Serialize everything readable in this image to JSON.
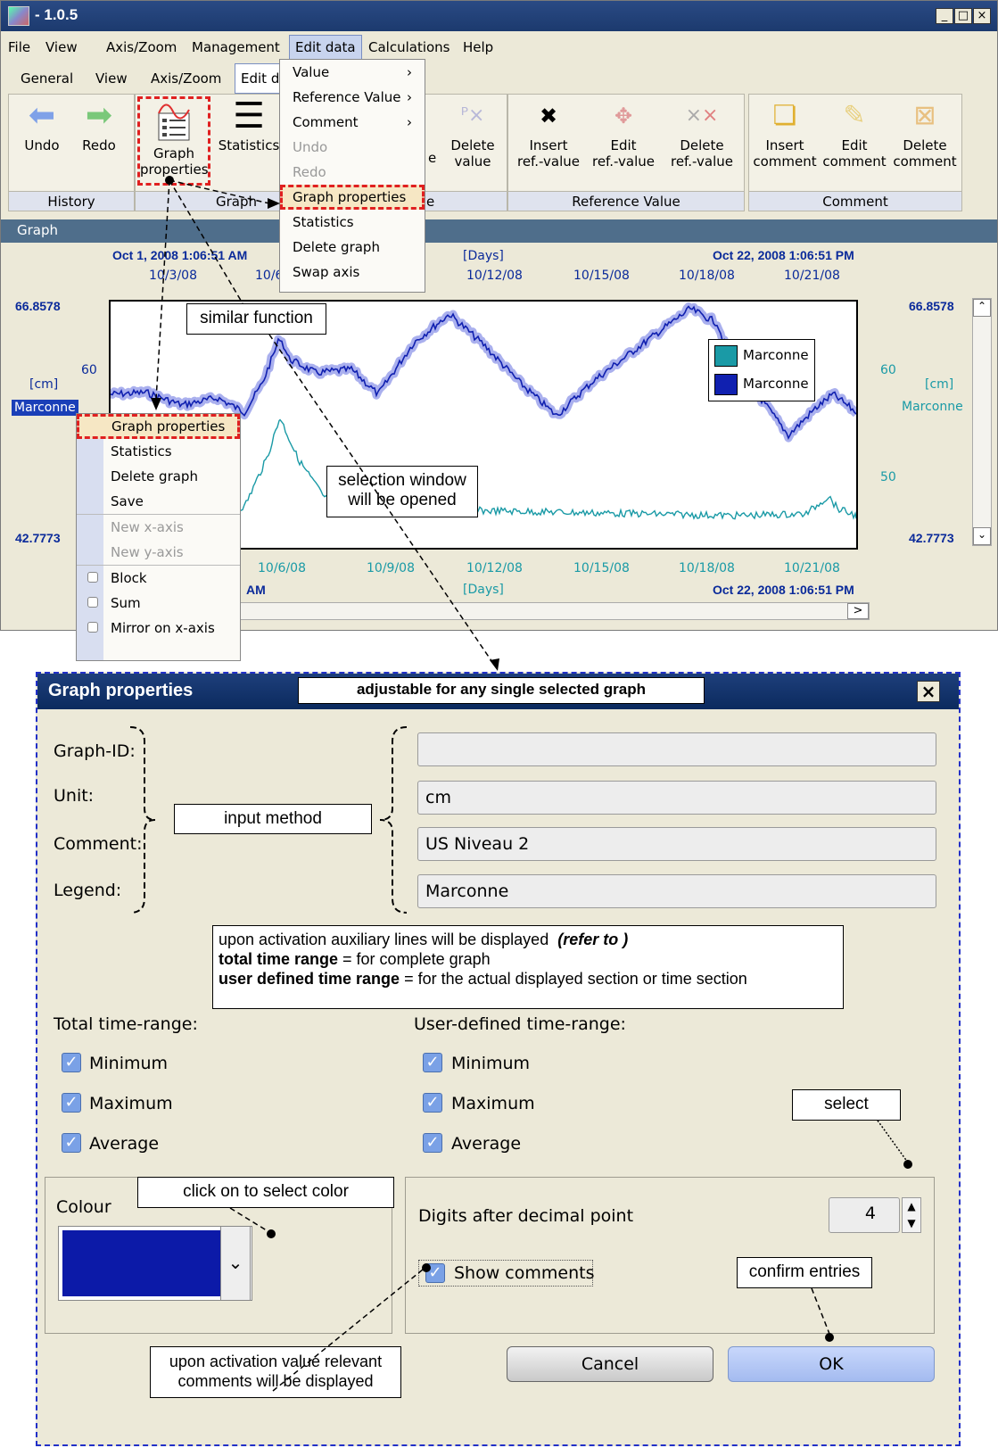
{
  "app": {
    "title": "- 1.0.5",
    "menus": [
      "File",
      "View",
      "Axis/Zoom",
      "Management",
      "Edit data",
      "Calculations",
      "Help"
    ],
    "tabs": [
      "General",
      "View",
      "Axis/Zoom",
      "Edit da"
    ],
    "ribbon": {
      "history": {
        "undo": "Undo",
        "redo": "Redo",
        "label": "History"
      },
      "graph": {
        "props_line1": "Graph",
        "props_line2": "properties",
        "statistics": "Statistics",
        "label": "Graph"
      },
      "value": {
        "partial1": "e",
        "delete1": "Delete",
        "delete2": "value",
        "label": "e"
      },
      "refvalue": {
        "insert1": "Insert",
        "insert2": "ref.-value",
        "edit1": "Edit",
        "edit2": "ref.-value",
        "delete1": "Delete",
        "delete2": "ref.-value",
        "label": "Reference Value"
      },
      "comment": {
        "insert1": "Insert",
        "insert2": "comment",
        "edit1": "Edit",
        "edit2": "comment",
        "delete1": "Delete",
        "delete2": "comment",
        "label": "Comment"
      }
    },
    "edit_menu": [
      "Value",
      "Reference Value",
      "Comment",
      "Undo",
      "Redo",
      "Graph properties",
      "Statistics",
      "Delete graph",
      "Swap axis"
    ],
    "graph_header": "Graph",
    "plot": {
      "top_left_time": "Oct 1, 2008 1:06:51 AM",
      "top_right_time": "Oct 22, 2008 1:06:51 PM",
      "bottom_right_time": "Oct 22, 2008 1:06:51 PM",
      "bottom_left_frag": "AM",
      "unit_days_top": "[Days]",
      "unit_days_bottom": "[Days]",
      "x_ticks_top": [
        "10/3/08",
        "10/6",
        "10/12/08",
        "10/15/08",
        "10/18/08",
        "10/21/08"
      ],
      "x_ticks_bottom": [
        "10/6/08",
        "10/9/08",
        "10/12/08",
        "10/15/08",
        "10/18/08",
        "10/21/08"
      ],
      "y_max_left": "66.8578",
      "y_min_left": "42.7773",
      "y_max_right": "66.8578",
      "y_min_right": "42.7773",
      "y_tick_left_60": "60",
      "y_tick_right_60": "60",
      "y_tick_right_50": "50",
      "unit_left": "[cm]",
      "unit_right": "[cm]",
      "series_tag_left": "Marconne",
      "series_tag_right": "Marconne",
      "legend": [
        "Marconne",
        "Marconne"
      ],
      "colors": {
        "teal": "#1a9aa6",
        "blue": "#1020b0",
        "halo": "#aab0ee"
      }
    },
    "context_menu": [
      "Graph properties",
      "Statistics",
      "Delete graph",
      "Save",
      "New x-axis",
      "New y-axis",
      "Block",
      "Sum",
      "Mirror on x-axis"
    ]
  },
  "annotations": {
    "similar": "similar function",
    "selection_line1": "selection window",
    "selection_line2": "will be opened",
    "adjustable": "adjustable for any single selected graph",
    "input_method": "input method",
    "aux_line1": "upon activation auxiliary lines will be displayed",
    "aux_refer": "(refer to )",
    "aux_line2_bold": "total time range",
    "aux_line2_rest": " = for complete graph",
    "aux_line3_bold": "user defined time range",
    "aux_line3_rest": " = for the actual displayed section or time section",
    "select": "select",
    "click_color": "click on to select color",
    "confirm": "confirm entries",
    "comments_line1": "upon activation value relevant",
    "comments_line2": "comments will be displayed"
  },
  "dialog": {
    "title": "Graph properties",
    "labels": {
      "graph_id": "Graph-ID:",
      "unit": "Unit:",
      "comment": "Comment:",
      "legend": "Legend:"
    },
    "values": {
      "graph_id": "",
      "unit": "cm",
      "comment": "US Niveau 2",
      "legend": "Marconne"
    },
    "total_range": "Total time-range:",
    "user_range": "User-defined time-range:",
    "checks": [
      "Minimum",
      "Maximum",
      "Average"
    ],
    "colour_label": "Colour",
    "colour_value": "#0c1aa8",
    "digits_label": "Digits after decimal point",
    "digits_value": "4",
    "show_comments": "Show comments",
    "cancel": "Cancel",
    "ok": "OK"
  }
}
